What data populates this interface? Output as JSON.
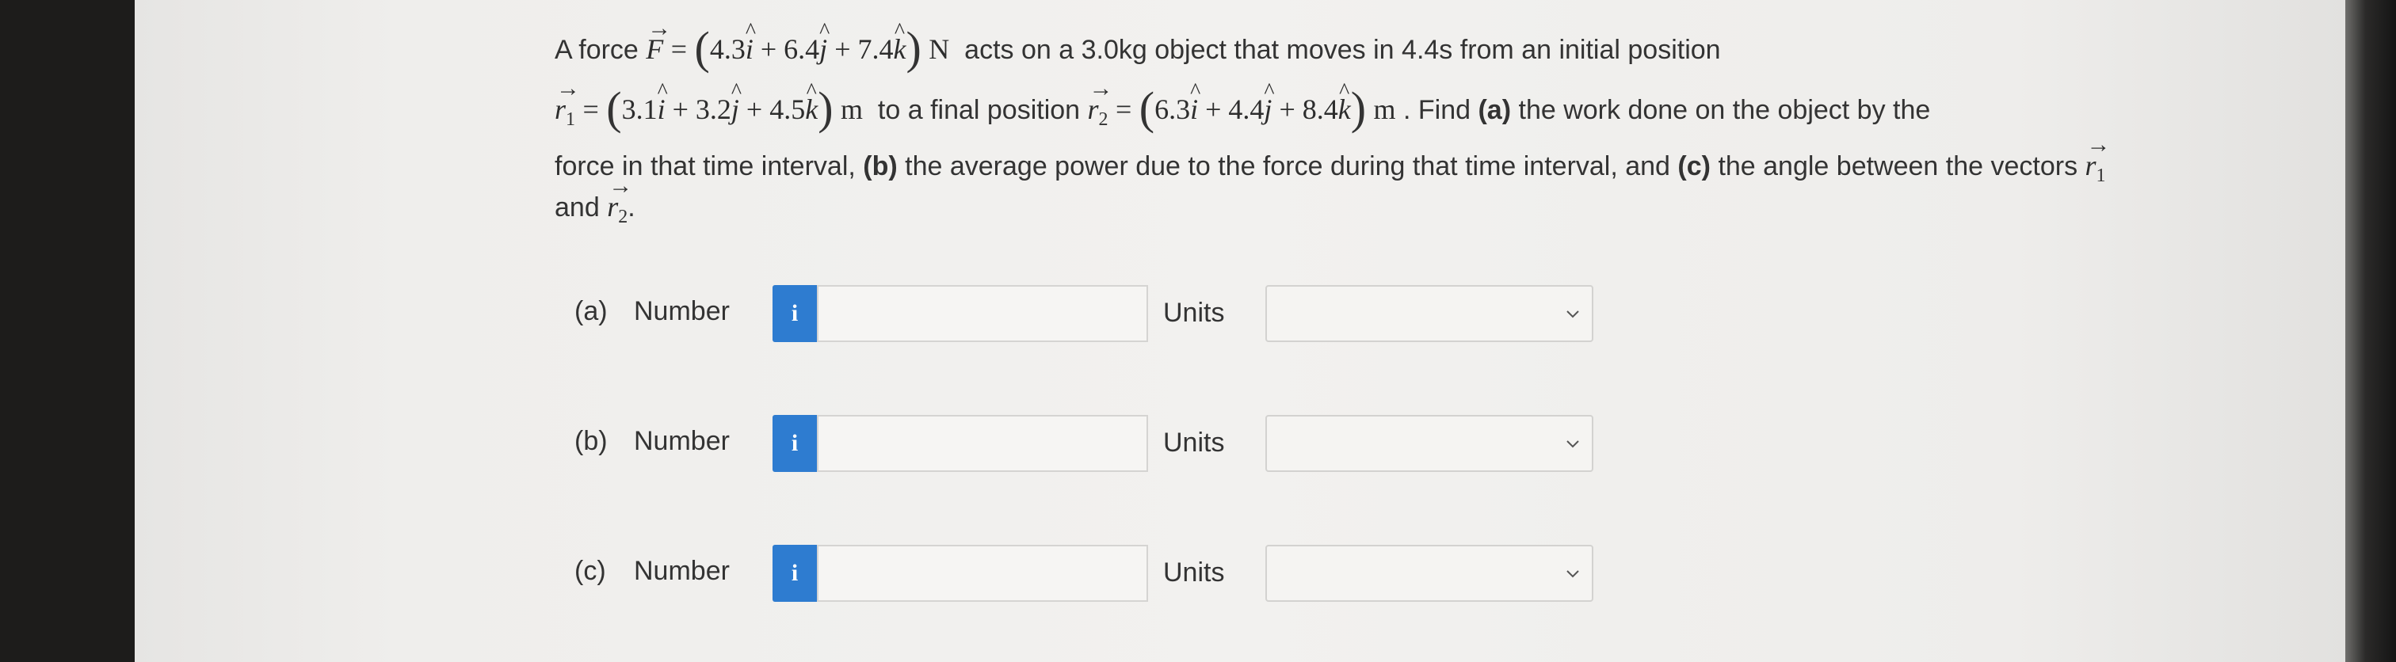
{
  "question": {
    "l1_a": "A force",
    "force_symbol": "F",
    "eq": "=",
    "force_vec": [
      "4.3",
      "6.4",
      "7.4"
    ],
    "force_unit": "N",
    "l1_b": "acts on a 3.0kg object that moves in 4.4s from an initial position",
    "r_symbol": "r",
    "r1_sub": "1",
    "r1_vec": [
      "3.1",
      "3.2",
      "4.5"
    ],
    "pos_unit": "m",
    "l2_a": "to a final position",
    "r2_sub": "2",
    "r2_vec": [
      "6.3",
      "4.4",
      "8.4"
    ],
    "l2_b": ". Find",
    "tag_a": "(a)",
    "l2_c": "the work done on the object by the",
    "l3_a": "force in that time interval,",
    "tag_b": "(b)",
    "l3_b": "the average power due to the force during that time interval, and",
    "tag_c": "(c)",
    "l3_c": "the angle between the vectors",
    "l4_a": "and",
    "period": ".",
    "plus": "+",
    "i_hat": "i",
    "j_hat": "j",
    "k_hat": "k",
    "hat_glyph": "^",
    "arrow_glyph": "→"
  },
  "parts": [
    {
      "label": "(a)",
      "number_label": "Number",
      "info": "i",
      "value": "",
      "units_label": "Units",
      "units_value": ""
    },
    {
      "label": "(b)",
      "number_label": "Number",
      "info": "i",
      "value": "",
      "units_label": "Units",
      "units_value": ""
    },
    {
      "label": "(c)",
      "number_label": "Number",
      "info": "i",
      "value": "",
      "units_label": "Units",
      "units_value": ""
    }
  ],
  "icons": {
    "info": "info-icon",
    "dropdown": "chevron-down-icon",
    "cursor": "mouse-pointer-icon"
  },
  "colors": {
    "info_button": "#2e7cd0",
    "background": "#f2f1ef"
  }
}
